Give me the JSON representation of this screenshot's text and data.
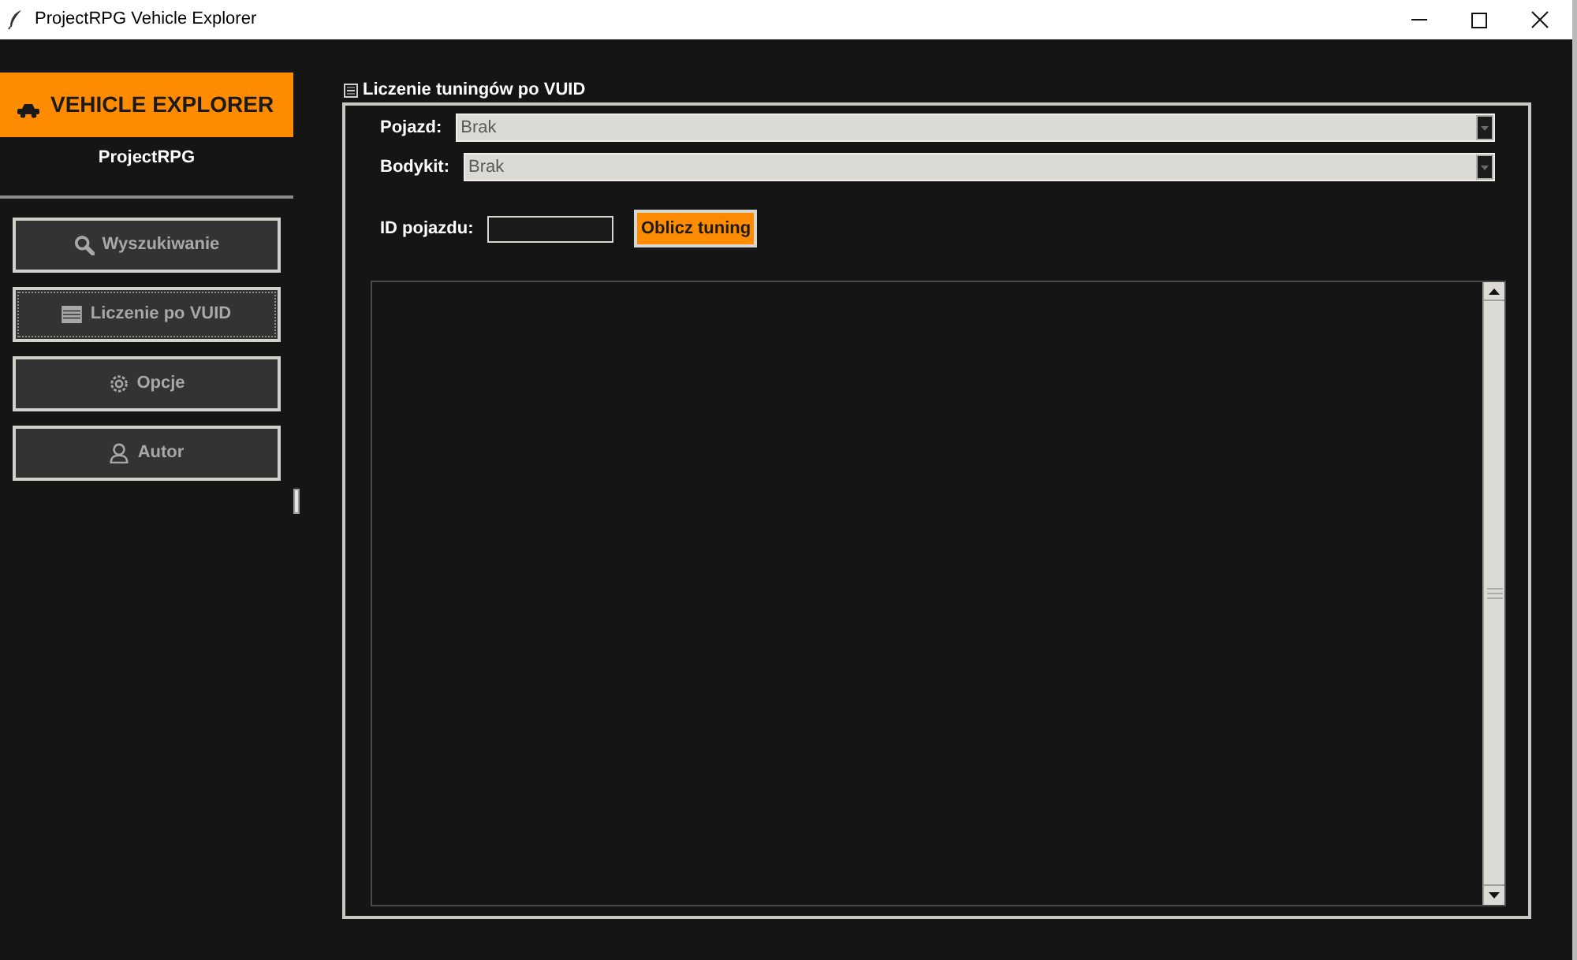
{
  "window": {
    "title": "ProjectRPG Vehicle Explorer"
  },
  "sidebar": {
    "header": "VEHICLE EXPLORER",
    "subtitle": "ProjectRPG",
    "nav_items": [
      {
        "label": "Wyszukiwanie",
        "focused": false
      },
      {
        "label": "Liczenie po VUID",
        "focused": true
      },
      {
        "label": "Opcje",
        "focused": false
      },
      {
        "label": "Autor",
        "focused": false
      }
    ]
  },
  "section": {
    "title": "Liczenie tuningów po VUID",
    "expanded": true,
    "selects": [
      {
        "label": "Pojazd:",
        "value": "Brak"
      },
      {
        "label": "Bodykit:",
        "value": "Brak"
      }
    ],
    "id_field": {
      "label": "ID pojazdu:"
    },
    "calculate_button": "Oblicz tuning"
  }
}
